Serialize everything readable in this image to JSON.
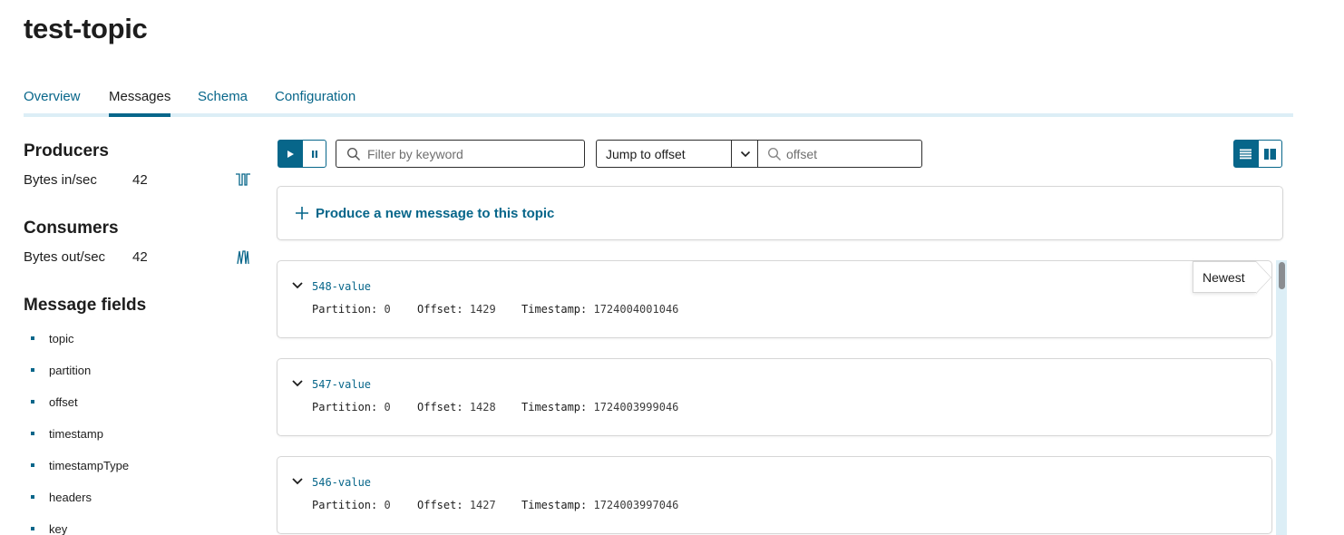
{
  "page": {
    "title": "test-topic"
  },
  "tabs": [
    {
      "label": "Overview"
    },
    {
      "label": "Messages"
    },
    {
      "label": "Schema"
    },
    {
      "label": "Configuration"
    }
  ],
  "active_tab": "Messages",
  "sidebar": {
    "producers": {
      "heading": "Producers",
      "metric_label": "Bytes in/sec",
      "metric_value": "42",
      "icon": "sparkline-icon"
    },
    "consumers": {
      "heading": "Consumers",
      "metric_label": "Bytes out/sec",
      "metric_value": "42",
      "icon": "sparkline-icon"
    },
    "fields_heading": "Message fields",
    "fields": [
      "topic",
      "partition",
      "offset",
      "timestamp",
      "timestampType",
      "headers",
      "key"
    ]
  },
  "toolbar": {
    "play_icon": "play-icon",
    "pause_icon": "pause-icon",
    "filter": {
      "placeholder": "Filter by keyword",
      "value": ""
    },
    "jump_select": {
      "selected": "Jump to offset"
    },
    "offset": {
      "placeholder": "offset",
      "value": ""
    },
    "view_icons": [
      "list-view-icon",
      "split-view-icon"
    ]
  },
  "produce": {
    "label": "Produce a new message to this topic",
    "icon": "plus-icon"
  },
  "messages": [
    {
      "key": "548-value",
      "partition_label": "Partition:",
      "partition": "0",
      "offset_label": "Offset:",
      "offset": "1429",
      "timestamp_label": "Timestamp:",
      "timestamp": "1724004001046"
    },
    {
      "key": "547-value",
      "partition_label": "Partition:",
      "partition": "0",
      "offset_label": "Offset:",
      "offset": "1428",
      "timestamp_label": "Timestamp:",
      "timestamp": "1724003999046"
    },
    {
      "key": "546-value",
      "partition_label": "Partition:",
      "partition": "0",
      "offset_label": "Offset:",
      "offset": "1427",
      "timestamp_label": "Timestamp:",
      "timestamp": "1724003997046"
    }
  ],
  "newest_label": "Newest",
  "colors": {
    "accent": "#07668a",
    "accent_light": "#dceef6",
    "border": "#d6d6d6"
  }
}
